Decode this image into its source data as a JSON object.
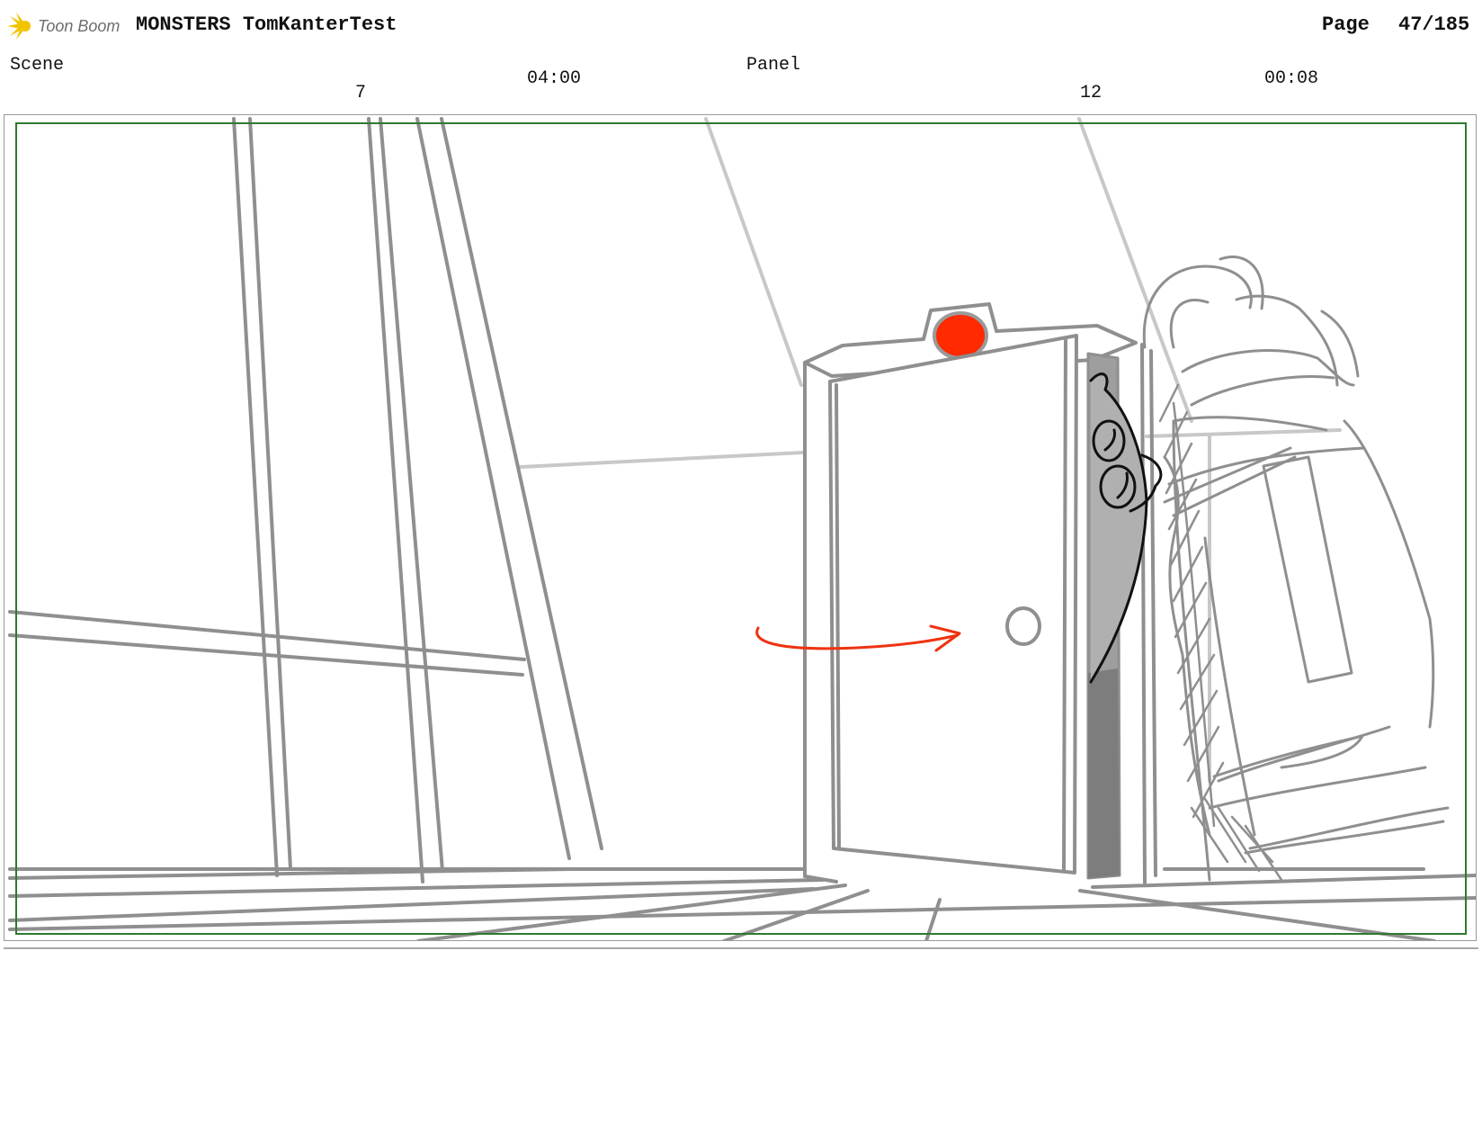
{
  "header": {
    "logo_text": "Toon Boom",
    "project_title": "MONSTERS TomKanterTest",
    "page_label": "Page",
    "page_number": "47/185"
  },
  "scene": {
    "label": "Scene",
    "number": "7",
    "duration": "04:00"
  },
  "panel": {
    "label": "Panel",
    "number": "12",
    "duration": "00:08"
  },
  "colors": {
    "safe_frame": "#2e7a2e",
    "sketch_line": "#8f8f8f",
    "light_line": "#c8c8c8",
    "door_light": "#ff2a00",
    "motion_arrow": "#ee3311",
    "shadow": "#9e9e9e"
  }
}
